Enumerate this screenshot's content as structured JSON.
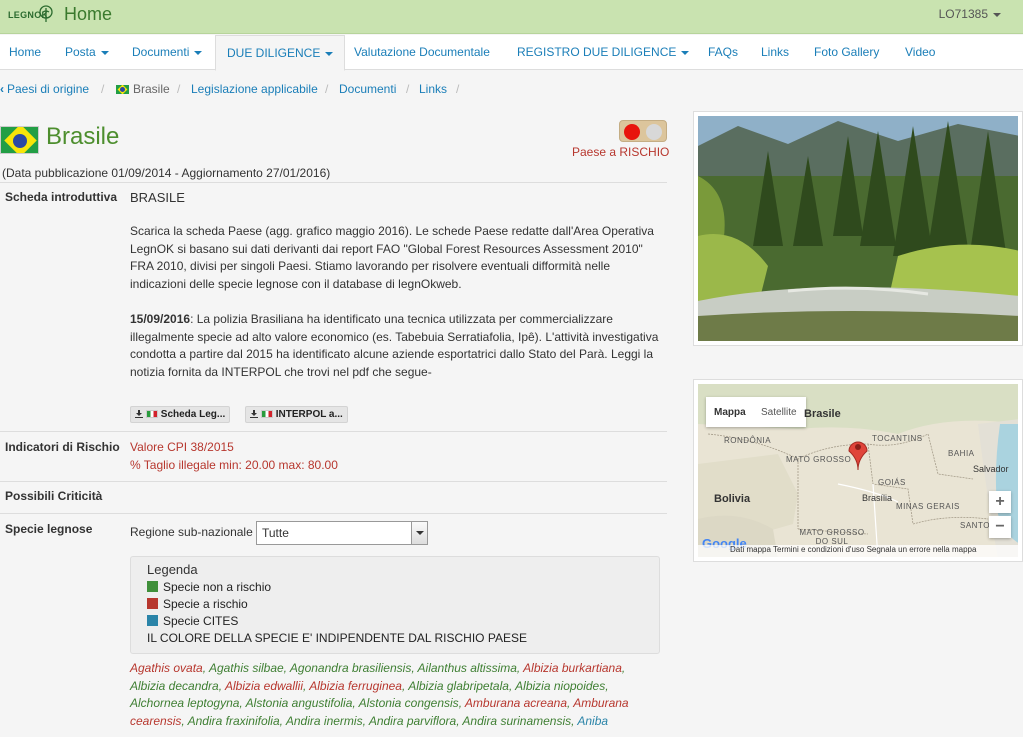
{
  "header": {
    "logo_text": "LEGNOK",
    "title": "Home",
    "user": "LO71385"
  },
  "nav": {
    "items": [
      {
        "label": "Home"
      },
      {
        "label": "Posta"
      },
      {
        "label": "Documenti"
      },
      {
        "label": "DUE DILIGENCE"
      },
      {
        "label": "Valutazione Documentale"
      },
      {
        "label": "REGISTRO DUE DILIGENCE"
      },
      {
        "label": "FAQs"
      },
      {
        "label": "Links"
      },
      {
        "label": "Foto Gallery"
      },
      {
        "label": "Video"
      }
    ]
  },
  "breadcrumb": {
    "items": [
      {
        "label": "Paesi di origine"
      },
      {
        "label": "Brasile"
      },
      {
        "label": "Legislazione applicabile"
      },
      {
        "label": "Documenti"
      },
      {
        "label": "Links"
      }
    ]
  },
  "country": {
    "name": "Brasile",
    "risk_label": "Paese a RISCHIO",
    "pub_date": "(Data pubblicazione 01/09/2014 - Aggiornamento 27/01/2016)",
    "risk_colors": {
      "active": "#e8140c",
      "inactive": "#d8d8d8"
    }
  },
  "scheda": {
    "label": "Scheda introduttiva",
    "heading": "BRASILE",
    "para1": "Scarica la scheda Paese (agg. grafico maggio 2016). Le schede Paese redatte dall'Area Operativa LegnOK si basano sui dati derivanti dai report FAO \"Global Forest Resources Assessment 2010\" FRA 2010, divisi per singoli Paesi. Stiamo lavorando per risolvere eventuali difformità nelle indicazioni delle specie legnose con il database di legnOkweb.",
    "news_date": "15/09/2016",
    "news_text": ": La polizia Brasiliana ha identificato una tecnica utilizzata per commercializzare illegalmente specie ad alto valore economico (es. Tabebuia Serratiafolia, Ipê). L'attività investigativa condotta a partire dal 2015 ha identificato alcune aziende esportatrici dallo Stato del Parà. Leggi la notizia fornita da INTERPOL che trovi nel pdf che segue-",
    "downloads": [
      {
        "label": "Scheda Leg..."
      },
      {
        "label": "INTERPOL a..."
      }
    ]
  },
  "indicatori": {
    "label": "Indicatori di Rischio",
    "cpi": "Valore CPI 38/2015",
    "taglio": "% Taglio illegale min: 20.00 max: 80.00"
  },
  "criticita": {
    "label": "Possibili Criticità"
  },
  "specie": {
    "label": "Specie legnose",
    "region_label": "Regione sub-nazionale",
    "region_value": "Tutte",
    "legend": {
      "title": "Legenda",
      "items": [
        {
          "label": "Specie non a rischio",
          "color": "#3f8f3a"
        },
        {
          "label": "Specie a rischio",
          "color": "#b7372e"
        },
        {
          "label": "Specie CITES",
          "color": "#2a84a8"
        }
      ],
      "note": "IL COLORE DELLA SPECIE E' INDIPENDENTE DAL RISCHIO PAESE"
    },
    "list": [
      {
        "name": "Agathis ovata",
        "status": "red"
      },
      {
        "name": "Agathis silbae",
        "status": "green"
      },
      {
        "name": "Agonandra brasiliensis",
        "status": "green"
      },
      {
        "name": "Ailanthus altissima",
        "status": "green"
      },
      {
        "name": "Albizia burkartiana",
        "status": "red"
      },
      {
        "name": "Albizia decandra",
        "status": "green"
      },
      {
        "name": "Albizia edwallii",
        "status": "red"
      },
      {
        "name": "Albizia ferruginea",
        "status": "red"
      },
      {
        "name": "Albizia glabripetala",
        "status": "green"
      },
      {
        "name": "Albizia niopoides",
        "status": "green"
      },
      {
        "name": "Alchornea leptogyna",
        "status": "green"
      },
      {
        "name": "Alstonia angustifolia",
        "status": "green"
      },
      {
        "name": "Alstonia congensis",
        "status": "green"
      },
      {
        "name": "Amburana acreana",
        "status": "red"
      },
      {
        "name": "Amburana cearensis",
        "status": "red"
      },
      {
        "name": "Andira fraxinifolia",
        "status": "green"
      },
      {
        "name": "Andira inermis",
        "status": "green"
      },
      {
        "name": "Andira parviflora",
        "status": "green"
      },
      {
        "name": "Andira surinamensis",
        "status": "green"
      },
      {
        "name": "Aniba",
        "status": "blue"
      }
    ]
  },
  "map": {
    "tab_map": "Mappa",
    "tab_sat": "Satellite",
    "labels": {
      "brasile": "Brasile",
      "rondonia": "RONDÔNIA",
      "tocantins": "TOCANTINS",
      "bahia": "BAHIA",
      "mato_grosso": "MATO GROSSO",
      "salvador": "Salvador",
      "bolivia": "Bolivia",
      "goias": "GOIÁS",
      "brasilia": "Brasília",
      "minas": "MINAS GERAIS",
      "ms": "MATO GROSSO DO SUL",
      "santo": "SANTO"
    },
    "zoom_in": "+",
    "zoom_out": "−",
    "google": "Google",
    "footer": "Dati mappa     Termini e condizioni d'uso     Segnala un errore nella mappa"
  }
}
